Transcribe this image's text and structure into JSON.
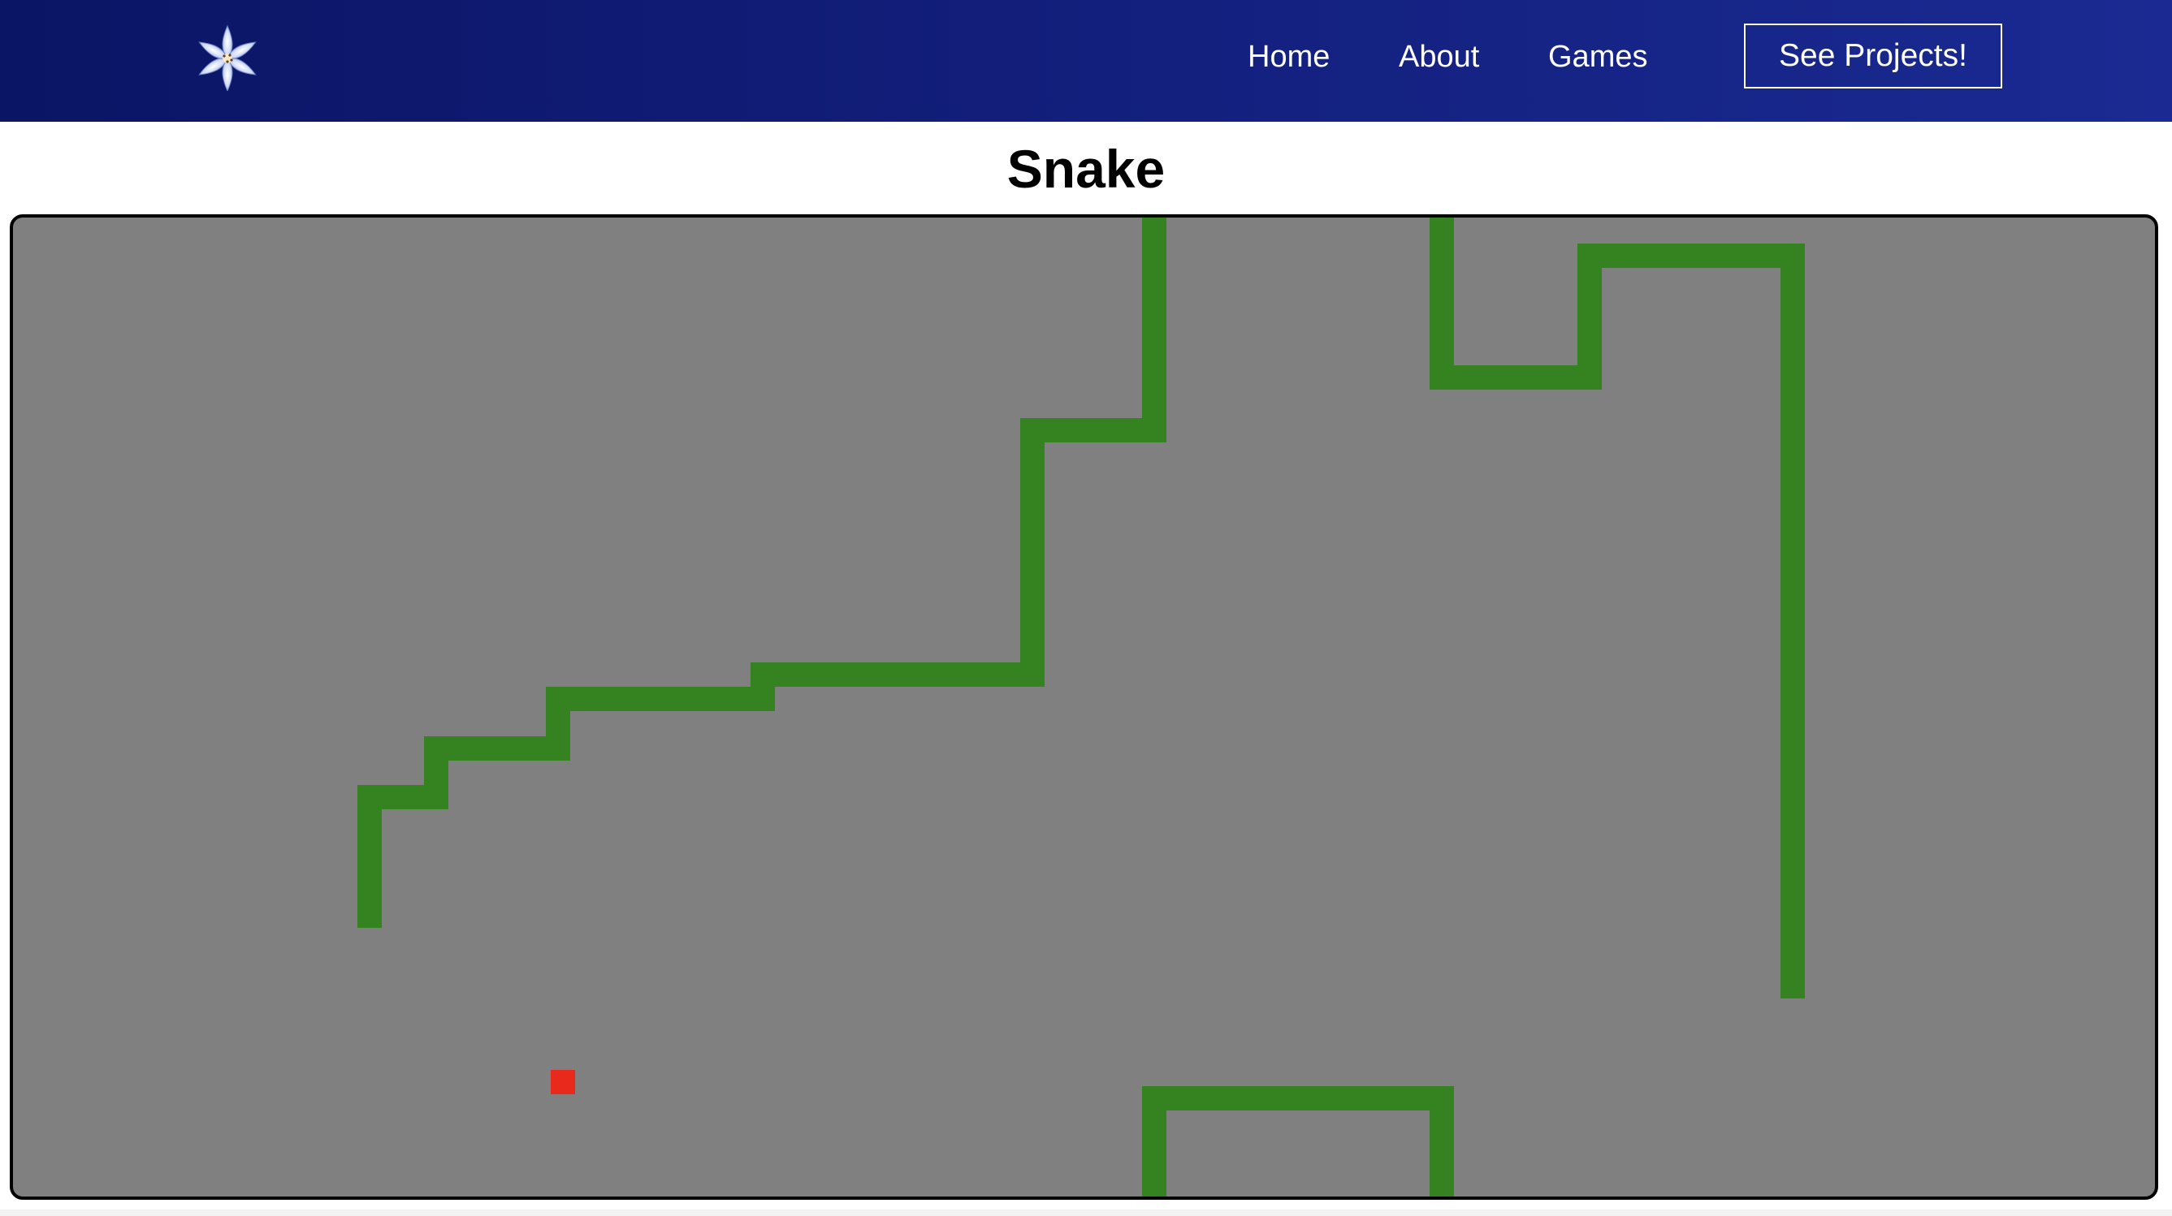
{
  "nav": {
    "logo_icon": "lily-flower-icon",
    "links": [
      "Home",
      "About",
      "Games"
    ],
    "cta_label": "See Projects!"
  },
  "page": {
    "title": "Snake"
  },
  "game": {
    "board_color": "#808080",
    "snake_color": "#358221",
    "food_color": "#e8291c"
  }
}
